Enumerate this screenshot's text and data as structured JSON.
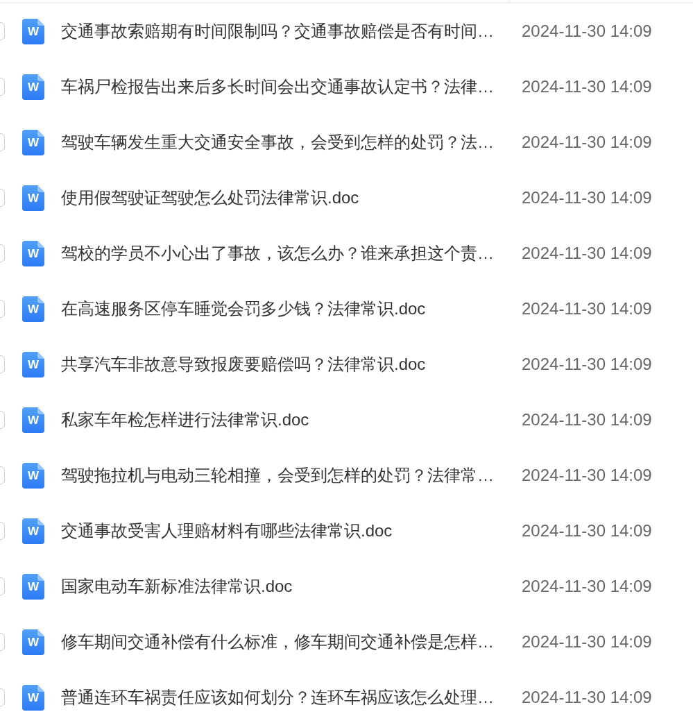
{
  "files": [
    {
      "checked": false,
      "type_label": "W",
      "name": "交通事故索赔期有时间限制吗？交通事故赔偿是否有时间…",
      "modified": "2024-11-30 14:09"
    },
    {
      "checked": false,
      "type_label": "W",
      "name": "车祸尸检报告出来后多长时间会出交通事故认定书？法律…",
      "modified": "2024-11-30 14:09"
    },
    {
      "checked": false,
      "type_label": "W",
      "name": "驾驶车辆发生重大交通安全事故，会受到怎样的处罚？法…",
      "modified": "2024-11-30 14:09"
    },
    {
      "checked": false,
      "type_label": "W",
      "name": "使用假驾驶证驾驶怎么处罚法律常识.doc",
      "modified": "2024-11-30 14:09"
    },
    {
      "checked": false,
      "type_label": "W",
      "name": "驾校的学员不小心出了事故，该怎么办？谁来承担这个责…",
      "modified": "2024-11-30 14:09"
    },
    {
      "checked": false,
      "type_label": "W",
      "name": "在高速服务区停车睡觉会罚多少钱？法律常识.doc",
      "modified": "2024-11-30 14:09"
    },
    {
      "checked": false,
      "type_label": "W",
      "name": "共享汽车非故意导致报废要赔偿吗？法律常识.doc",
      "modified": "2024-11-30 14:09"
    },
    {
      "checked": false,
      "type_label": "W",
      "name": "私家车年检怎样进行法律常识.doc",
      "modified": "2024-11-30 14:09"
    },
    {
      "checked": false,
      "type_label": "W",
      "name": "驾驶拖拉机与电动三轮相撞，会受到怎样的处罚？法律常…",
      "modified": "2024-11-30 14:09"
    },
    {
      "checked": false,
      "type_label": "W",
      "name": "交通事故受害人理赔材料有哪些法律常识.doc",
      "modified": "2024-11-30 14:09"
    },
    {
      "checked": false,
      "type_label": "W",
      "name": "国家电动车新标准法律常识.doc",
      "modified": "2024-11-30 14:09"
    },
    {
      "checked": false,
      "type_label": "W",
      "name": "修车期间交通补偿有什么标准，修车期间交通补偿是怎样…",
      "modified": "2024-11-30 14:09"
    },
    {
      "checked": false,
      "type_label": "W",
      "name": "普通连环车祸责任应该如何划分？连环车祸应该怎么处理…",
      "modified": "2024-11-30 14:09"
    }
  ]
}
